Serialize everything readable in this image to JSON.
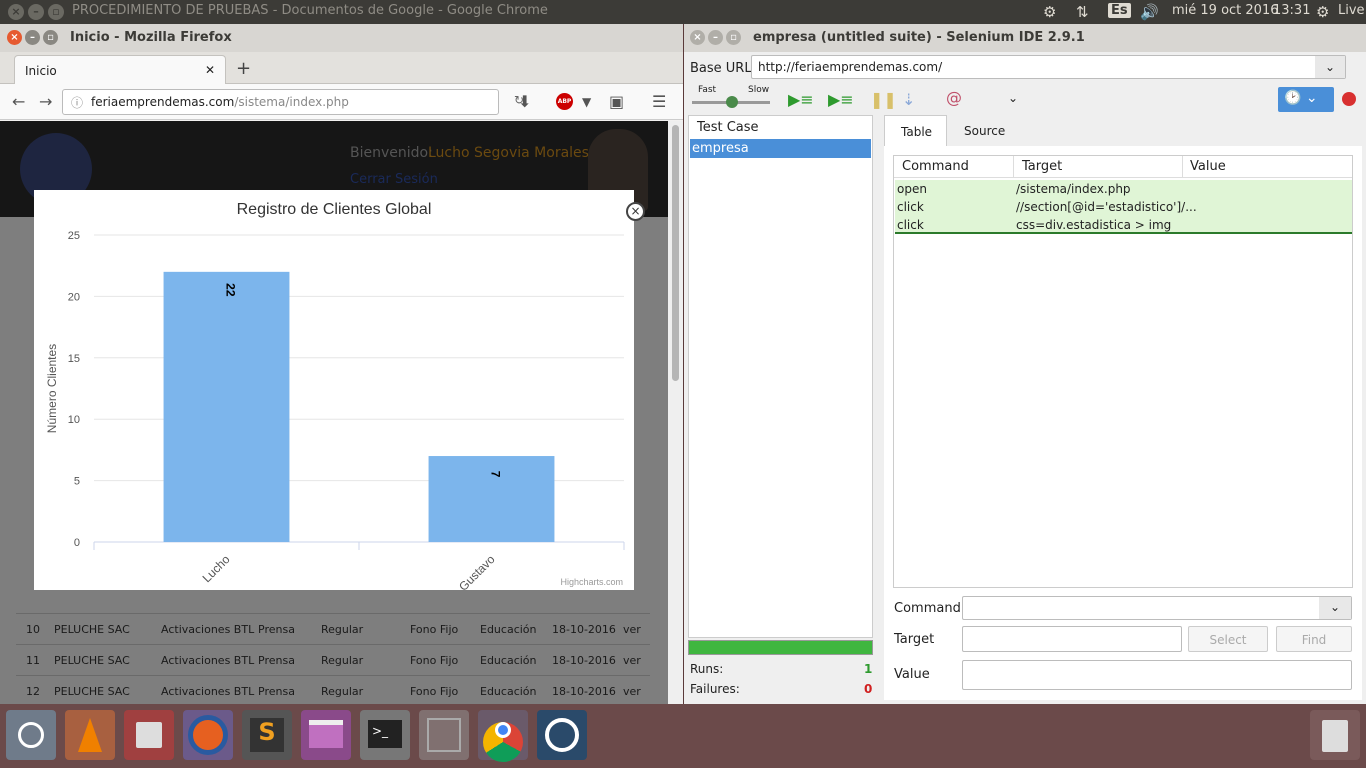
{
  "topbar": {
    "title": "PROCEDIMIENTO DE PRUEBAS - Documentos de Google - Google Chrome",
    "lang": "Es",
    "date": "mié 19 oct 2016",
    "time": "13:31",
    "live": "Live"
  },
  "firefox": {
    "title": "Inicio - Mozilla Firefox",
    "tab_label": "Inicio",
    "url_domain": "feriaemprendemas.com",
    "url_path": "/sistema/index.php",
    "page": {
      "welcome": "Bienvenido:",
      "user": "Lucho Segovia Morales",
      "logout": "Cerrar Sesión",
      "rows": [
        {
          "n": "10",
          "empresa": "PELUCHE SAC",
          "tipo": "Activaciones BTL",
          "medio": "Prensa",
          "estado": "Regular",
          "fono": "Fono Fijo",
          "rubro": "Educación",
          "fecha": "18-10-2016",
          "action": "ver"
        },
        {
          "n": "11",
          "empresa": "PELUCHE SAC",
          "tipo": "Activaciones BTL",
          "medio": "Prensa",
          "estado": "Regular",
          "fono": "Fono Fijo",
          "rubro": "Educación",
          "fecha": "18-10-2016",
          "action": "ver"
        },
        {
          "n": "12",
          "empresa": "PELUCHE SAC",
          "tipo": "Activaciones BTL",
          "medio": "Prensa",
          "estado": "Regular",
          "fono": "Fono Fijo",
          "rubro": "Educación",
          "fecha": "18-10-2016",
          "action": "ver"
        }
      ]
    }
  },
  "chart_data": {
    "type": "bar",
    "title": "Registro de Clientes Global",
    "ylabel": "Número Clientes",
    "xlabel": "",
    "categories": [
      "Lucho",
      "Gustavo"
    ],
    "values": [
      22,
      7
    ],
    "yticks": [
      "0",
      "5",
      "10",
      "15",
      "20",
      "25"
    ],
    "ylim": [
      0,
      25
    ],
    "grid": true,
    "bar_color": "#7cb5ec",
    "credit": "Highcharts.com"
  },
  "selenium": {
    "title": "empresa (untitled suite) - Selenium IDE 2.9.1",
    "base_url_label": "Base URL",
    "base_url": "http://feriaemprendemas.com/",
    "fast": "Fast",
    "slow": "Slow",
    "testcase_header": "Test Case",
    "testcase_item": "empresa",
    "tab_table": "Table",
    "tab_source": "Source",
    "col_command": "Command",
    "col_target": "Target",
    "col_value": "Value",
    "commands": [
      {
        "command": "open",
        "target": "/sistema/index.php",
        "value": ""
      },
      {
        "command": "click",
        "target": "//section[@id='estadistico']/...",
        "value": ""
      },
      {
        "command": "click",
        "target": "css=div.estadistica > img",
        "value": ""
      }
    ],
    "command_label": "Command",
    "target_label": "Target",
    "value_label": "Value",
    "select_btn": "Select",
    "find_btn": "Find",
    "runs_label": "Runs:",
    "runs": "1",
    "failures_label": "Failures:",
    "failures": "0"
  }
}
